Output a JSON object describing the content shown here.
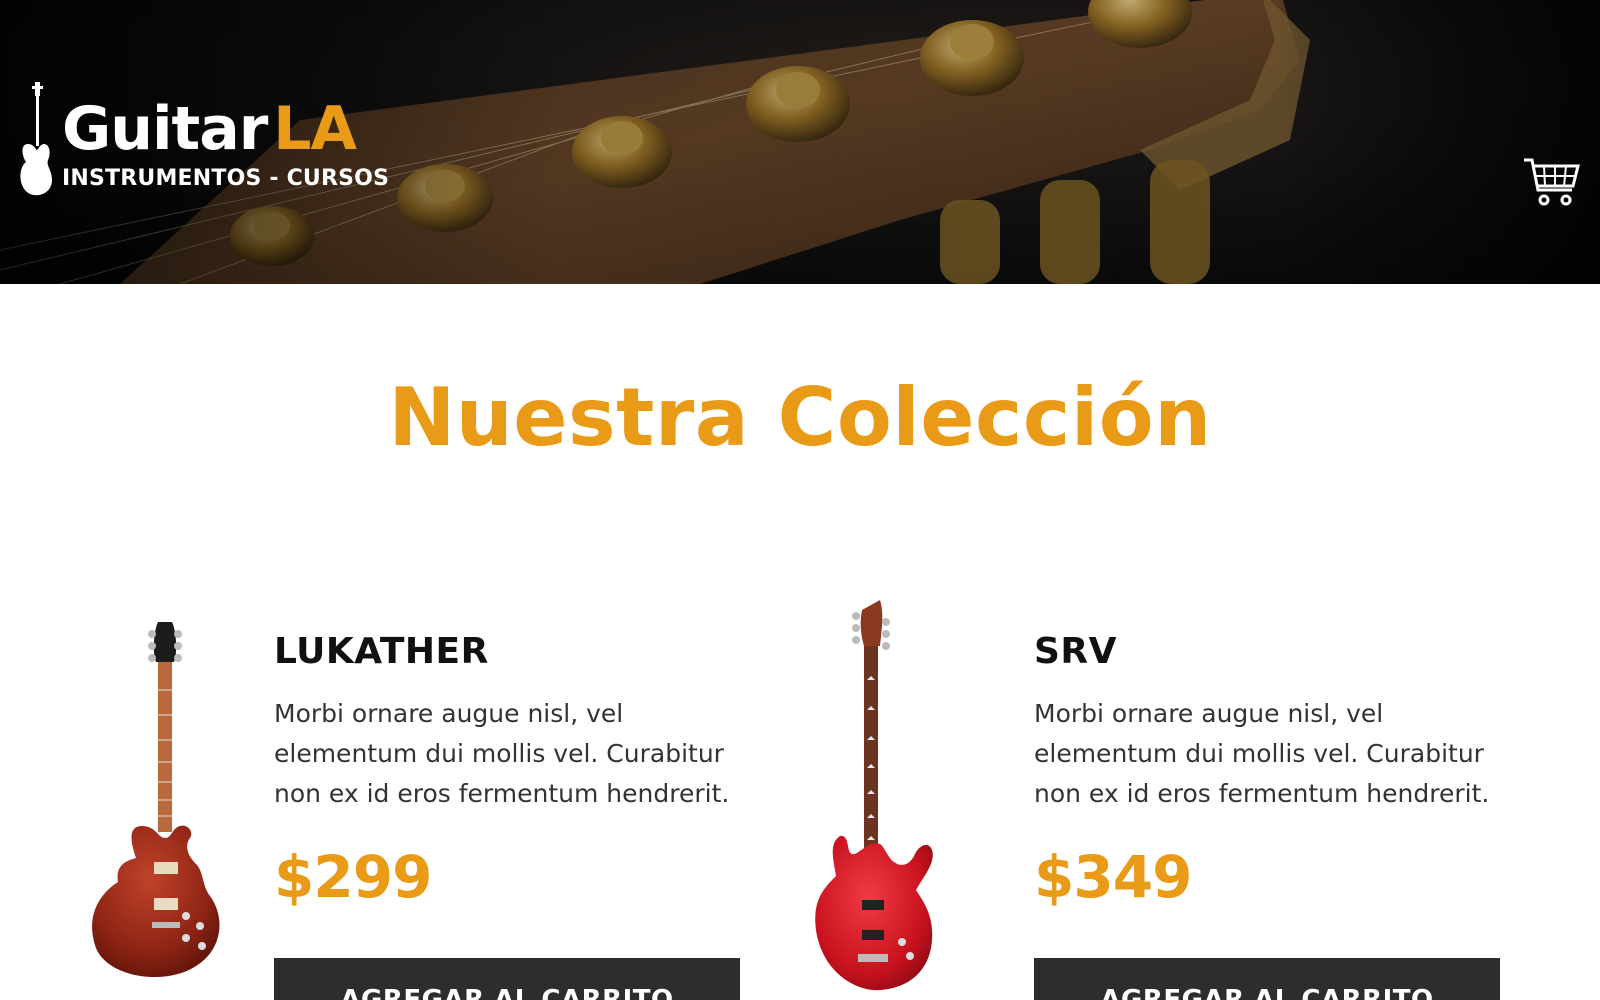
{
  "header": {
    "logo": {
      "word_main": "Guitar",
      "word_accent": "LA",
      "tagline": "INSTRUMENTOS - CURSOS"
    },
    "cart_icon": "cart-icon"
  },
  "main": {
    "title": "Nuestra Colección",
    "products": [
      {
        "name": "LUKATHER",
        "description": "Morbi ornare augue nisl, vel elementum dui mollis vel. Curabitur non ex id eros fermentum hendrerit.",
        "price": "$299",
        "button_label": "AGREGAR AL CARRITO",
        "image": "guitar-lespaul-image"
      },
      {
        "name": "SRV",
        "description": "Morbi ornare augue nisl, vel elementum dui mollis vel. Curabitur non ex id eros fermentum hendrerit.",
        "price": "$349",
        "button_label": "AGREGAR AL CARRITO",
        "image": "guitar-strat-image"
      }
    ]
  },
  "colors": {
    "accent": "#e99a16",
    "button_bg": "#2d2d2d",
    "text_dark": "#111111"
  }
}
